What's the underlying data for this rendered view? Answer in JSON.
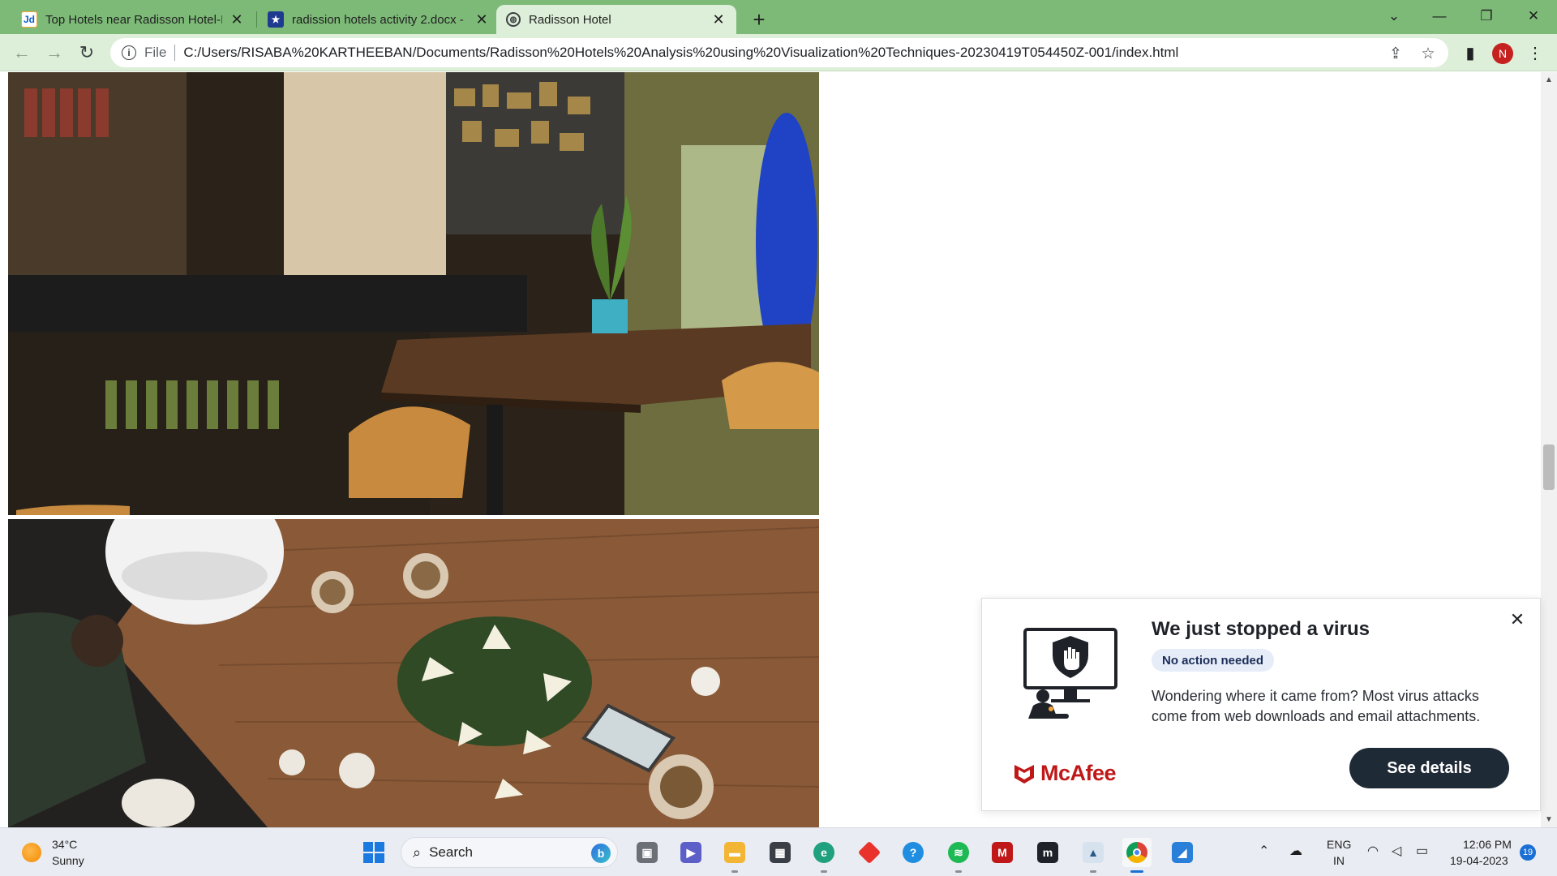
{
  "browser": {
    "tabs": [
      {
        "label": "Top Hotels near Radisson Hotel-I",
        "icon": "justdial-icon"
      },
      {
        "label": "radission hotels activity 2.docx - |",
        "icon": "document-icon"
      },
      {
        "label": "Radisson Hotel",
        "icon": "globe-icon",
        "active": true
      }
    ],
    "address": {
      "scheme_label": "File",
      "url": "C:/Users/RISABA%20KARTHEEBAN/Documents/Radisson%20Hotels%20Analysis%20using%20Visualization%20Techniques-20230419T054450Z-001/index.html"
    },
    "profile_initial": "N"
  },
  "page": {
    "photos": [
      {
        "name": "cafe-interior-photo"
      },
      {
        "name": "dining-table-photo"
      }
    ]
  },
  "popup": {
    "title": "We just stopped a virus",
    "badge": "No action needed",
    "body": "Wondering where it came from? Most virus attacks come from web downloads and email attachments.",
    "brand": "McAfee",
    "button_label": "See details",
    "brand_color": "#c01818"
  },
  "taskbar": {
    "weather": {
      "temp": "34°C",
      "desc": "Sunny"
    },
    "search_label": "Search",
    "lang_line1": "ENG",
    "lang_line2": "IN",
    "time": "12:06 PM",
    "date": "19-04-2023",
    "notification_count": "19",
    "pinned_apps": [
      "windows-start-icon",
      "task-view-icon",
      "teams-icon",
      "file-explorer-icon",
      "microsoft-store-icon",
      "edge-icon",
      "app-red-diamond-icon",
      "help-icon",
      "spotify-icon",
      "mcafee-icon",
      "app-m-icon",
      "app-photo-icon",
      "chrome-icon",
      "app-blue-icon"
    ]
  }
}
